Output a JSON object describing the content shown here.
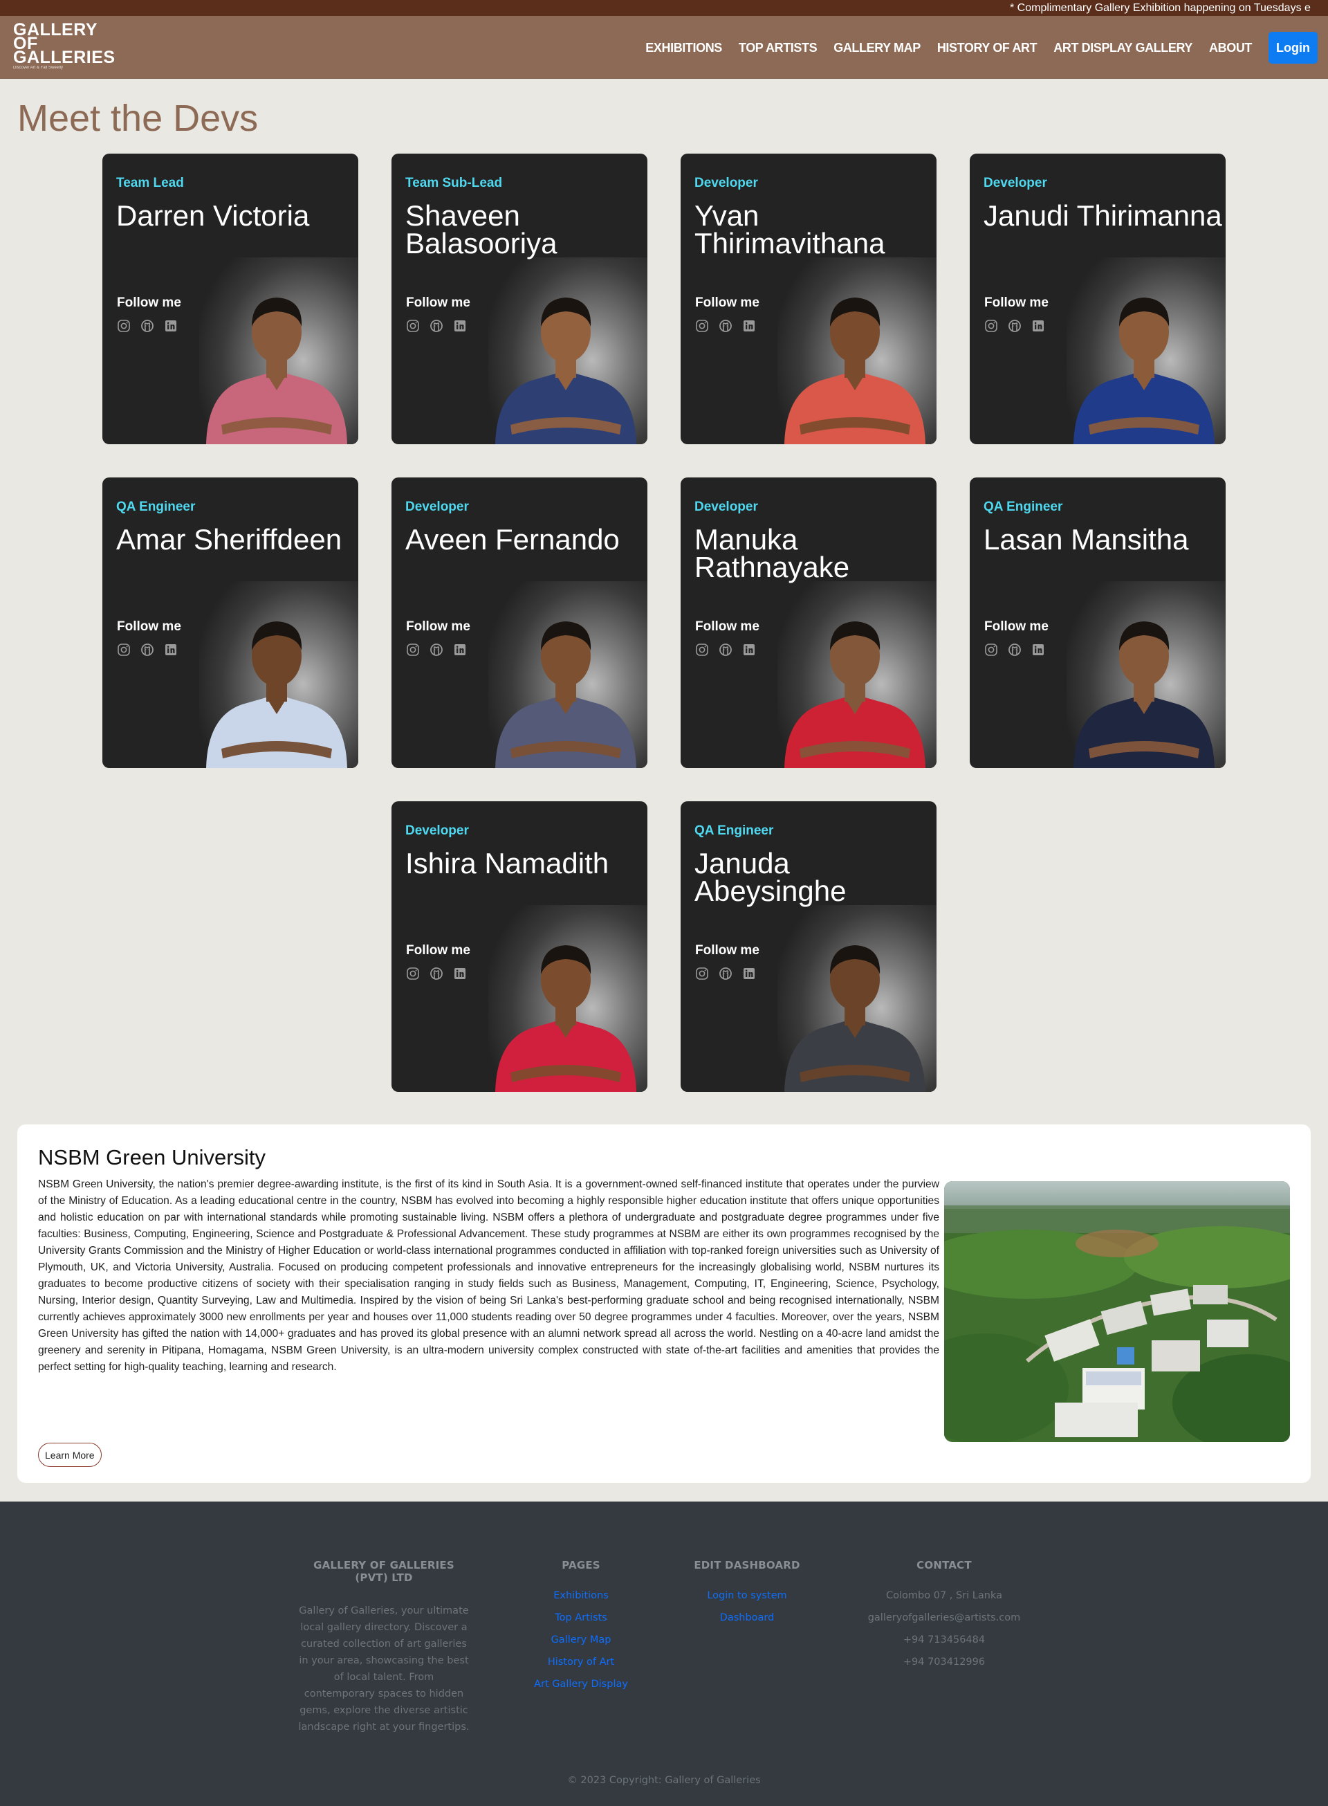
{
  "announcement": "* Complimentary Gallery Exhibition happening on Tuesdays e",
  "brand": {
    "line1": "GALLERY",
    "line2": "OF",
    "line3": "GALLERIES",
    "tagline": "Discover Art & Fall Sweetly"
  },
  "nav": {
    "items": [
      "EXHIBITIONS",
      "TOP ARTISTS",
      "GALLERY MAP",
      "HISTORY OF ART",
      "ART DISPLAY GALLERY",
      "ABOUT"
    ],
    "login": "Login"
  },
  "page_title": "Meet the Devs",
  "follow_label": "Follow me",
  "devs": [
    {
      "role": "Team Lead",
      "name": "Darren Victoria",
      "shirt": "#c8667c",
      "skin": "#8a5a3c"
    },
    {
      "role": "Team Sub-Lead",
      "name": "Shaveen Balasooriya",
      "shirt": "#2e3f73",
      "skin": "#94613f"
    },
    {
      "role": "Developer",
      "name": "Yvan Thirimavithana",
      "shirt": "#d9584a",
      "skin": "#7a4b2c"
    },
    {
      "role": "Developer",
      "name": "Janudi Thirimanna",
      "shirt": "#1f3b8a",
      "skin": "#8c5c3a"
    },
    {
      "role": "QA Engineer",
      "name": "Amar Sheriffdeen",
      "shirt": "#c9d6ea",
      "skin": "#6e4529"
    },
    {
      "role": "Developer",
      "name": "Aveen Fernando",
      "shirt": "#545a78",
      "skin": "#7d5031"
    },
    {
      "role": "Developer",
      "name": "Manuka Rathnayake",
      "shirt": "#cc2233",
      "skin": "#83573a"
    },
    {
      "role": "QA Engineer",
      "name": "Lasan Mansitha",
      "shirt": "#1f2640",
      "skin": "#87593b"
    },
    {
      "role": "Developer",
      "name": "Ishira Namadith",
      "shirt": "#d1203d",
      "skin": "#7b4d2e"
    },
    {
      "role": "QA Engineer",
      "name": "Januda Abeysinghe",
      "shirt": "#3b3f45",
      "skin": "#6a4328"
    }
  ],
  "university": {
    "title": "NSBM Green University",
    "description": "NSBM Green University, the nation's premier degree-awarding institute, is the first of its kind in South Asia. It is a government-owned self-financed institute that operates under the purview of the Ministry of Education. As a leading educational centre in the country, NSBM has evolved into becoming a highly responsible higher education institute that offers unique opportunities and holistic education on par with international standards while promoting sustainable living. NSBM offers a plethora of undergraduate and postgraduate degree programmes under five faculties: Business, Computing, Engineering, Science and Postgraduate & Professional Advancement. These study programmes at NSBM are either its own programmes recognised by the University Grants Commission and the Ministry of Higher Education or world-class international programmes conducted in affiliation with top-ranked foreign universities such as University of Plymouth, UK, and Victoria University, Australia. Focused on producing competent professionals and innovative entrepreneurs for the increasingly globalising world, NSBM nurtures its graduates to become productive citizens of society with their specialisation ranging in study fields such as Business, Management, Computing, IT, Engineering, Science, Psychology, Nursing, Interior design, Quantity Surveying, Law and Multimedia. Inspired by the vision of being Sri Lanka's best-performing graduate school and being recognised internationally, NSBM currently achieves approximately 3000 new enrollments per year and houses over 11,000 students reading over 50 degree programmes under 4 faculties. Moreover, over the years, NSBM Green University has gifted the nation with 14,000+ graduates and has proved its global presence with an alumni network spread all across the world. Nestling on a 40-acre land amidst the greenery and serenity in Pitipana, Homagama, NSBM Green University, is an ultra-modern university complex constructed with state of-the-art facilities and amenities that provides the perfect setting for high-quality teaching, learning and research.",
    "button": "Learn More"
  },
  "footer": {
    "company": {
      "heading": "GALLERY OF GALLERIES (PVT) LTD",
      "text": "Gallery of Galleries, your ultimate local gallery directory. Discover a curated collection of art galleries in your area, showcasing the best of local talent. From contemporary spaces to hidden gems, explore the diverse artistic landscape right at your fingertips."
    },
    "pages": {
      "heading": "PAGES",
      "links": [
        "Exhibitions",
        "Top Artists",
        "Gallery Map",
        "History of Art",
        "Art Gallery Display"
      ]
    },
    "dashboard": {
      "heading": "EDIT DASHBOARD",
      "links": [
        "Login to system",
        "Dashboard"
      ]
    },
    "contact": {
      "heading": "CONTACT",
      "lines": [
        "Colombo 07 , Sri Lanka",
        "galleryofgalleries@artists.com",
        "+94 713456484",
        "+94 703412996"
      ]
    },
    "copyright": "© 2023 Copyright: Gallery of Galleries"
  },
  "colors": {
    "nav_bg": "#8c6a55",
    "announcement_bg": "#5b2e1c",
    "role_accent": "#4fd9f0",
    "login_btn": "#0d7cf2",
    "footer_bg": "#343a40"
  }
}
